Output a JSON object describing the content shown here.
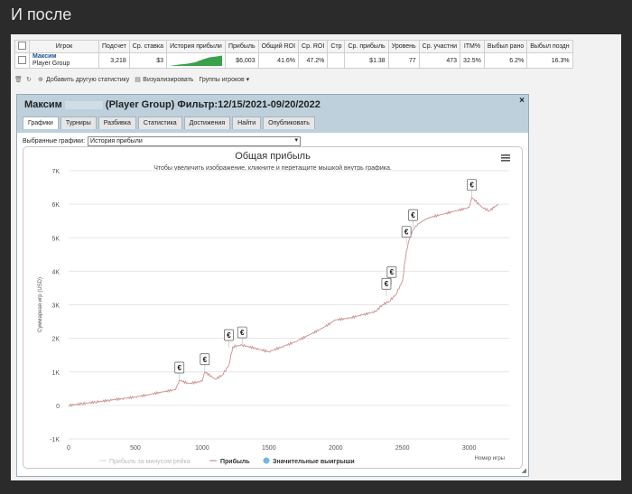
{
  "page_heading": "И после",
  "table": {
    "headers": [
      "Игрок",
      "Подсчет",
      "Ср. ставка",
      "История прибыли",
      "Прибыль",
      "Общий ROI",
      "Ср. ROI",
      "Стр",
      "Ср. прибыль",
      "Уровень",
      "Ср. участни",
      "ITM%",
      "Выбыл рано",
      "Выбыл поздн"
    ],
    "row": {
      "player_name": "Максим",
      "player_group": "Player Group",
      "count": "3,218",
      "avg_stake": "$3",
      "profit": "$6,003",
      "total_roi": "41.6%",
      "avg_roi": "47.2%",
      "str": "",
      "avg_profit": "$1.38",
      "level": "77",
      "avg_participants": "473",
      "itm": "32.5%",
      "early_out": "6.2%",
      "late_out": "16.3%"
    }
  },
  "toolbar": {
    "add_stat": "Добавить другую статистику",
    "visualize": "Визуализировать",
    "player_groups": "Группы игроков ▾"
  },
  "dialog": {
    "title_name": "Максим",
    "title_rest": "(Player Group) Фильтр:12/15/2021-09/20/2022",
    "close": "×",
    "tabs": [
      "Графики",
      "Турниры",
      "Разбивка",
      "Статистика",
      "Достижения",
      "Найти",
      "Опубликовать"
    ],
    "select_label": "Выбранные графики:",
    "select_value": "История прибыли"
  },
  "chart_data": {
    "type": "line",
    "title": "Общая прибыль",
    "subtitle": "Чтобы увеличить изображение, кликните и перетащите мышкой внутрь графика.",
    "xlabel": "Номер игры",
    "ylabel": "Суммарная игр (USD)",
    "xlim": [
      0,
      3300
    ],
    "ylim": [
      -1000,
      7000
    ],
    "xticks": [
      0,
      500,
      1000,
      1500,
      2000,
      2500,
      3000
    ],
    "yticks": [
      -1000,
      0,
      1000,
      2000,
      3000,
      4000,
      5000,
      6000,
      7000
    ],
    "ytick_labels": [
      "-1K",
      "0",
      "1K",
      "2K",
      "3K",
      "4K",
      "5K",
      "6K",
      "7K"
    ],
    "series": [
      {
        "name": "Прибыль за минусом рейка",
        "values": []
      },
      {
        "name": "Прибыль",
        "x": [
          0,
          100,
          200,
          300,
          400,
          500,
          600,
          700,
          800,
          830,
          900,
          1000,
          1020,
          1100,
          1150,
          1200,
          1230,
          1300,
          1400,
          1500,
          1600,
          1700,
          1800,
          1900,
          2000,
          2100,
          2200,
          2300,
          2350,
          2400,
          2450,
          2500,
          2530,
          2560,
          2600,
          2650,
          2700,
          2800,
          2900,
          3000,
          3020,
          3100,
          3150,
          3218
        ],
        "values": [
          0,
          50,
          100,
          150,
          200,
          250,
          320,
          400,
          470,
          750,
          650,
          720,
          1000,
          780,
          900,
          1200,
          1750,
          1800,
          1700,
          1600,
          1750,
          1900,
          2100,
          2300,
          2550,
          2600,
          2700,
          2800,
          3000,
          3100,
          3300,
          3700,
          4600,
          5100,
          5350,
          5500,
          5600,
          5700,
          5800,
          5900,
          6200,
          5900,
          5800,
          6000
        ]
      },
      {
        "name": "Значительные выигрыши",
        "x": [
          830,
          1020,
          1200,
          1300,
          2380,
          2420,
          2530,
          2580,
          3020
        ],
        "values": [
          750,
          1000,
          1720,
          1800,
          3250,
          3600,
          4800,
          5300,
          6200
        ]
      }
    ],
    "marker_label": "€",
    "legend": [
      "Прибыль за минусом рейка",
      "Прибыль",
      "Значительные выигрыши"
    ],
    "legend_position": "bottom",
    "grid": true
  }
}
